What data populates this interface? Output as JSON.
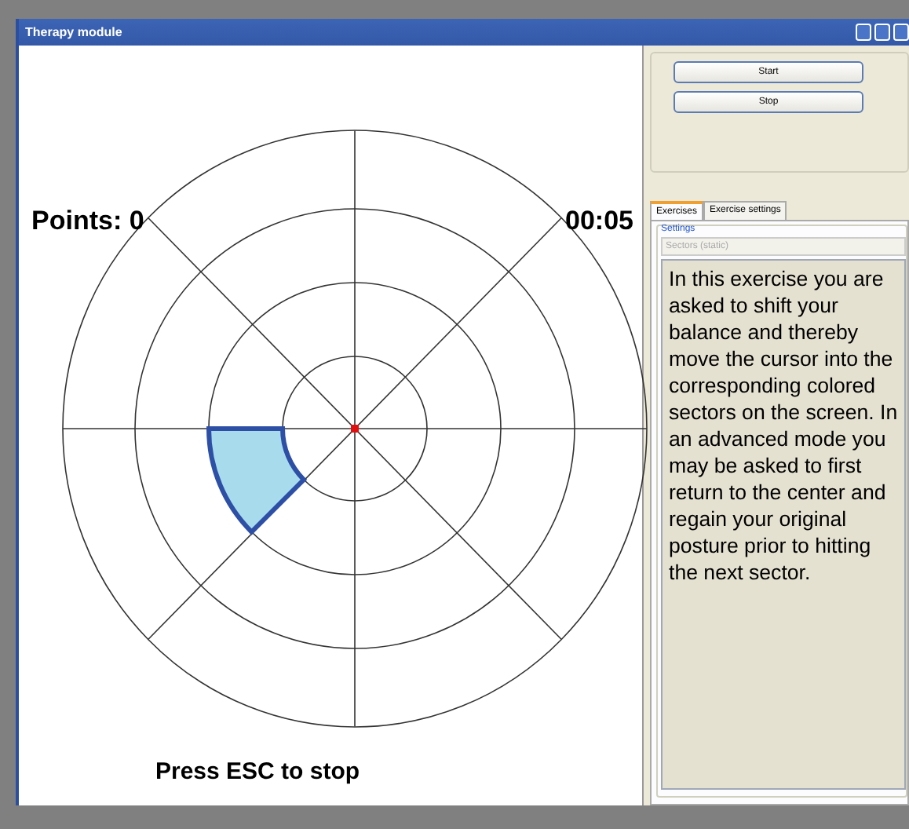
{
  "window": {
    "title": "Therapy module"
  },
  "game": {
    "points": "Points: 0",
    "timer": "00:05",
    "hint": "Press ESC to stop"
  },
  "controls": {
    "buttons": [
      "Start",
      "Stop"
    ]
  },
  "tabs": [
    {
      "label": "Exercises",
      "selected": true
    },
    {
      "label": "Exercise settings",
      "selected": false
    }
  ],
  "settings": {
    "group_label": "Settings",
    "dropdown": {
      "value": "Sectors (static)",
      "disabled": true
    },
    "description": "In this exercise you are asked to shift your balance and thereby move the cursor into the corresponding colored sectors on the screen. In an advanced mode you may be asked to first return to the center and regain your original posture prior to hitting the next sector."
  }
}
